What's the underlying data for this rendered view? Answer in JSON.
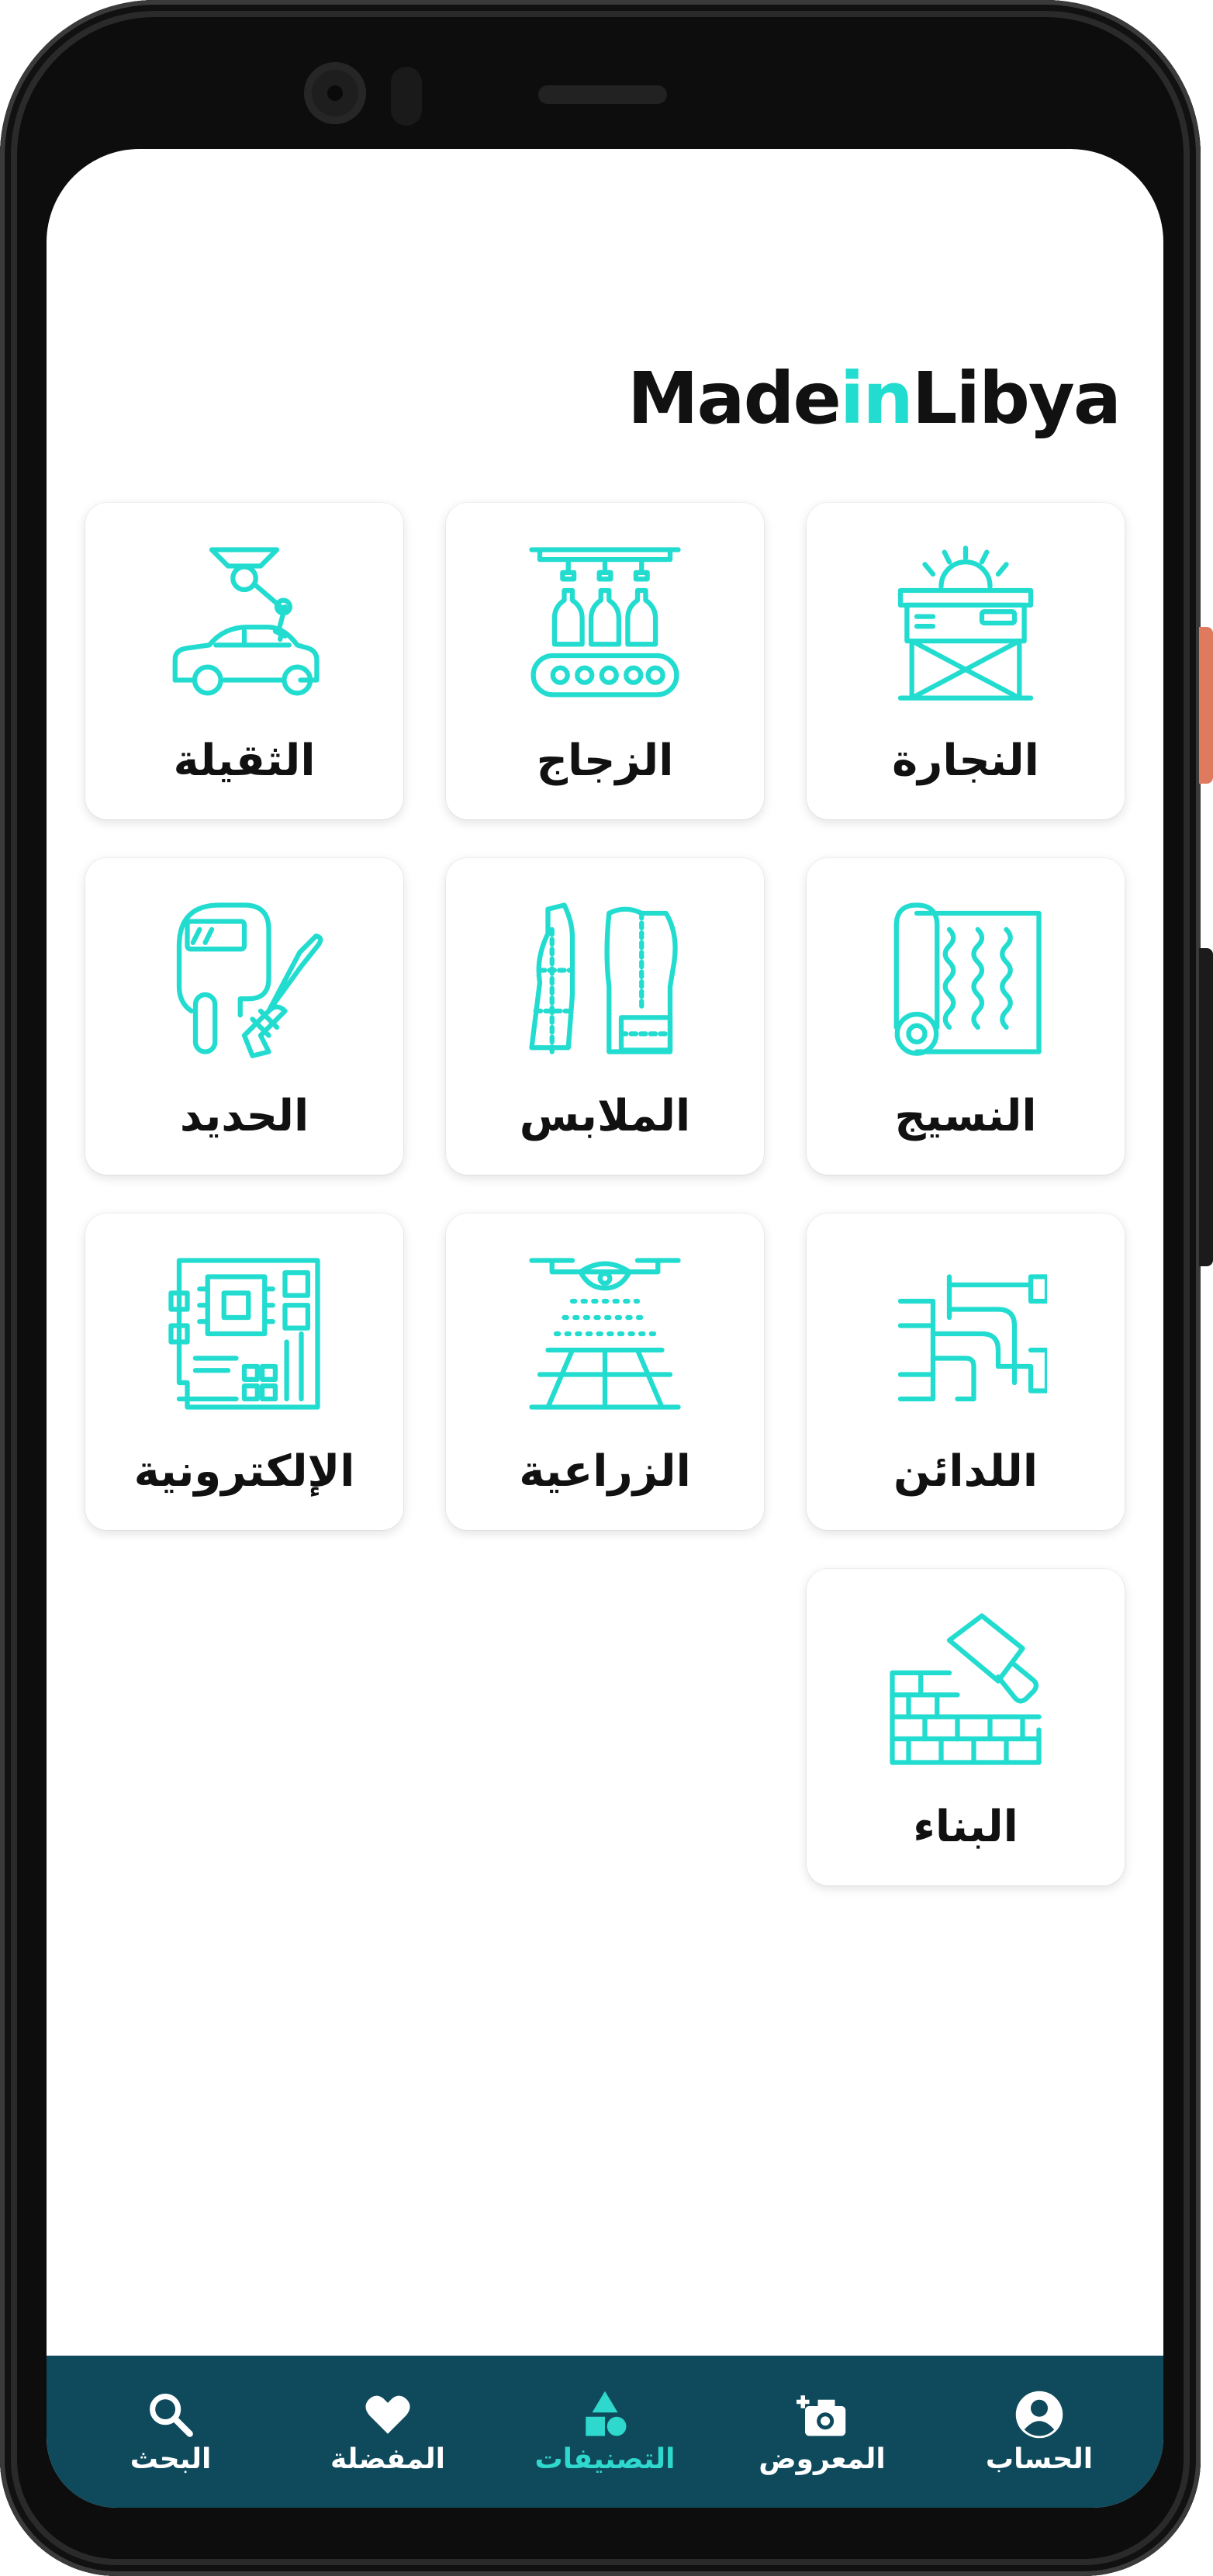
{
  "app": {
    "logo_part1": "Made",
    "logo_part2": "in",
    "logo_part3": "Libya"
  },
  "categories": [
    {
      "label": "النجارة",
      "icon": "table-saw-icon"
    },
    {
      "label": "الزجاج",
      "icon": "bottling-conveyor-icon"
    },
    {
      "label": "الثقيلة",
      "icon": "robot-arm-car-icon"
    },
    {
      "label": "النسيج",
      "icon": "fabric-roll-icon"
    },
    {
      "label": "الملابس",
      "icon": "garment-pattern-icon"
    },
    {
      "label": "الحديد",
      "icon": "welding-mask-icon"
    },
    {
      "label": "اللدائن",
      "icon": "pipes-icon"
    },
    {
      "label": "الزراعية",
      "icon": "spraying-drone-icon"
    },
    {
      "label": "الإلكترونية",
      "icon": "circuit-board-icon"
    },
    {
      "label": "البناء",
      "icon": "brick-trowel-icon"
    }
  ],
  "nav": {
    "items": [
      {
        "label": "الحساب",
        "icon": "account-icon"
      },
      {
        "label": "المعروض",
        "icon": "add-photo-icon"
      },
      {
        "label": "التصنيفات",
        "icon": "categories-shapes-icon"
      },
      {
        "label": "المفضلة",
        "icon": "heart-icon"
      },
      {
        "label": "البحث",
        "icon": "search-icon"
      }
    ],
    "active_index": 2
  },
  "colors": {
    "accent": "#23dcd0",
    "nav_bg": "#0e4a5c",
    "nav_active": "#2fd8cc"
  }
}
